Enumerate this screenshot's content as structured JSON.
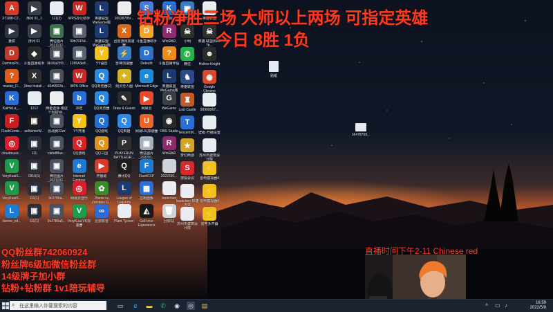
{
  "overlays": {
    "title_line1": "钻粉净胜三场 大师以上两场 可指定英雄",
    "title_line2": "今日 8胜 1负",
    "fan_lines": [
      "QQ粉丝群742060924",
      "粉丝牌6级加微信粉丝群",
      "14级牌子加小群",
      "钻粉+钻粉群 1v1陪玩辅导"
    ],
    "live_time": "直播时间下午2-11 Chinese red"
  },
  "desktop_icons": [
    {
      "label": "XTU88-C2...",
      "color": "#d23b2b",
      "glyph": "A"
    },
    {
      "label": "序列 01_1",
      "color": "#3a3f48",
      "glyph": "▶"
    },
    {
      "label": "111(2)",
      "color": "#e9edf2",
      "glyph": ""
    },
    {
      "label": "WPS办公助手",
      "color": "#c62828",
      "glyph": "W"
    },
    {
      "label": "英雄联盟WeGame版",
      "color": "#1c3a6e",
      "glyph": "L"
    },
    {
      "label": "10028785r...",
      "color": "#ededed",
      "glyph": ""
    },
    {
      "label": "搜狗",
      "color": "#4b7bd8",
      "glyph": "S"
    },
    {
      "label": "酷狗",
      "color": "#2a71d6",
      "glyph": "K"
    },
    {
      "label": "量腐",
      "color": "#2f3440",
      "glyph": "▶"
    },
    {
      "label": "序列 01",
      "color": "#3a3f48",
      "glyph": "▶"
    },
    {
      "label": "微信图片_2021102...",
      "color": "#3f6e4a",
      "glyph": "▣"
    },
    {
      "label": "90b7615d...",
      "color": "#5a5f6b",
      "glyph": "▣"
    },
    {
      "label": "英雄联盟WeGame版",
      "color": "#1c3a6e",
      "glyph": "L"
    },
    {
      "label": "迅雷游戏加速器",
      "color": "#d86a1e",
      "glyph": "X"
    },
    {
      "label": "斗鱼直播助手",
      "color": "#f2a431",
      "glyph": "D"
    },
    {
      "label": "WinRAR",
      "color": "#8e2b6d",
      "glyph": "R"
    },
    {
      "label": "DaminoPri...",
      "color": "#c0392b",
      "glyph": "D"
    },
    {
      "label": "斗鱼直播助手",
      "color": "#2a2a2a",
      "glyph": "◆"
    },
    {
      "label": "9b16a23f3...",
      "color": "#4c4f57",
      "glyph": "▣"
    },
    {
      "label": "1285A3e8...",
      "color": "#596274",
      "glyph": "▣"
    },
    {
      "label": "YY语音",
      "color": "#f4c21b",
      "glyph": "Y"
    },
    {
      "label": "雷神加速器",
      "color": "#3a7cc4",
      "glyph": "⚡"
    },
    {
      "label": "DetectIt",
      "color": "#2b70c9",
      "glyph": "D"
    },
    {
      "label": "斗鱼直播伴侣",
      "color": "#f08a1c",
      "glyph": "?"
    },
    {
      "label": "master_D...",
      "color": "#e05c1a",
      "glyph": "?"
    },
    {
      "label": "Xbox Install...",
      "color": "#2e2e2e",
      "glyph": "X"
    },
    {
      "label": "d2d9502b...",
      "color": "#4c4f57",
      "glyph": "▣"
    },
    {
      "label": "WPS Office",
      "color": "#c62828",
      "glyph": "W"
    },
    {
      "label": "QQ浏览器(2)",
      "color": "#2a8ae3",
      "glyph": "Q"
    },
    {
      "label": "剑灵无人图",
      "color": "#d4b226",
      "glyph": "✦"
    },
    {
      "label": "Microsoft Edge",
      "color": "#1d8ad8",
      "glyph": "e"
    },
    {
      "label": "英雄联盟WeGame版",
      "color": "#1c3a6e",
      "glyph": "L"
    },
    {
      "label": "KaiHeLa_...",
      "color": "#2a6cd8",
      "glyph": "K"
    },
    {
      "label": "1212",
      "color": "#e9edf2",
      "glyph": ""
    },
    {
      "label": "两者选择-用这个包括Wi...",
      "color": "#ededed",
      "glyph": ""
    },
    {
      "label": "中旺",
      "color": "#2b6fd6",
      "glyph": "b"
    },
    {
      "label": "QQ浏览器",
      "color": "#2a8ae3",
      "glyph": "Q"
    },
    {
      "label": "Draw & Guess",
      "color": "#2b2b2b",
      "glyph": "✎"
    },
    {
      "label": "网易云",
      "color": "#e64a2a",
      "glyph": "▶"
    },
    {
      "label": "WeGame",
      "color": "#3b3f45",
      "glyph": "G"
    },
    {
      "label": "FlashCente...",
      "color": "#c81e1e",
      "glyph": "F"
    },
    {
      "label": "aeNemieW...",
      "color": "#1d1d1d",
      "glyph": "▣"
    },
    {
      "label": "原战赛22zz",
      "color": "#4a4f5a",
      "glyph": "▣"
    },
    {
      "label": "YY开播",
      "color": "#f4c21b",
      "glyph": "Y"
    },
    {
      "label": "QQ游戏",
      "color": "#2470d0",
      "glyph": "Q"
    },
    {
      "label": "QQ英雄",
      "color": "#2d89e5",
      "glyph": "Q"
    },
    {
      "label": "网易UU加速器",
      "color": "#e8662a",
      "glyph": "U"
    },
    {
      "label": "OBS Studio",
      "color": "#2a2a2a",
      "glyph": "◉"
    },
    {
      "label": "cloudmusic...",
      "color": "#d81e2a",
      "glyph": "◎"
    },
    {
      "label": "111",
      "color": "#2a2f3a",
      "glyph": "▣"
    },
    {
      "label": "clafe88ae...",
      "color": "#4a5160",
      "glyph": "▣"
    },
    {
      "label": "QQ游戏",
      "color": "#d52626",
      "glyph": "Q"
    },
    {
      "label": "QQ三国",
      "color": "#e0921e",
      "glyph": "Q"
    },
    {
      "label": "PLAYERUN BATTLEGR...",
      "color": "#2f2f2f",
      "glyph": "P"
    },
    {
      "label": "微信图片_202201...",
      "color": "#a8b0bc",
      "glyph": "▣"
    },
    {
      "label": "WinRAR",
      "color": "#8e2b6d",
      "glyph": "R"
    },
    {
      "label": "VeryKuaiS...",
      "color": "#1f9a4a",
      "glyph": "V"
    },
    {
      "label": "0916(1)",
      "color": "#2a2f3a",
      "glyph": "▣"
    },
    {
      "label": "微信图片_2021102...",
      "color": "#4a5160",
      "glyph": "▣"
    },
    {
      "label": "Internet Explorer",
      "color": "#1f7ad1",
      "glyph": "e"
    },
    {
      "label": "开播助",
      "color": "#d53a2a",
      "glyph": "▶"
    },
    {
      "label": "腾讯QQ",
      "color": "#1c1c1c",
      "glyph": "Q"
    },
    {
      "label": "FlashFXP",
      "color": "#1f7ad1",
      "glyph": "F"
    },
    {
      "label": "2022030...",
      "color": "#cfd4db",
      "glyph": ""
    },
    {
      "label": "VeryKuaiS...",
      "color": "#1f9a4a",
      "glyph": "V"
    },
    {
      "label": "111(1)",
      "color": "#2a2f3a",
      "glyph": "▣"
    },
    {
      "label": "9c2780a...",
      "color": "#4a5160",
      "glyph": "▣"
    },
    {
      "label": "网易云音乐",
      "color": "#d81e2a",
      "glyph": "◎"
    },
    {
      "label": "Plants vs Zombies G...",
      "color": "#3a8a2b",
      "glyph": "✿"
    },
    {
      "label": "League of Legends",
      "color": "#1c3a6e",
      "glyph": "L"
    },
    {
      "label": "控制面板",
      "color": "#2b6fd6",
      "glyph": "▦"
    },
    {
      "label": "Isuoichen",
      "color": "#e9edf2",
      "glyph": ""
    },
    {
      "label": "liveme_ed...",
      "color": "#1f7ad1",
      "glyph": "L"
    },
    {
      "label": "111(1)",
      "color": "#2a2f3a",
      "glyph": "▣"
    },
    {
      "label": "9c2780a5...",
      "color": "#4a5160",
      "glyph": "▣"
    },
    {
      "label": "VeryKuai.VK加速器",
      "color": "#1f9a4a",
      "glyph": "V"
    },
    {
      "label": "迅雷影音",
      "color": "#2a6cd8",
      "glyph": "∞"
    },
    {
      "label": "Plant Tycoon",
      "color": "#e9edf2",
      "glyph": ""
    },
    {
      "label": "GeForce Experience",
      "color": "#1a1a1a",
      "glyph": "◭"
    },
    {
      "label": "回收站",
      "color": "#cfd4db",
      "glyph": "🗑"
    }
  ],
  "right_icons": [
    {
      "label": "快捷方式(2)",
      "color": "#3a7cc4",
      "glyph": "▣"
    },
    {
      "label": "英雄联盟",
      "color": "#e9edf2",
      "glyph": ""
    },
    {
      "label": "小明",
      "color": "#2f2f2f",
      "glyph": "☠"
    },
    {
      "label": "英雄 联盟(Skul Th...",
      "color": "#2f2f2f",
      "glyph": "☠"
    },
    {
      "label": "微信",
      "color": "#24b24a",
      "glyph": "✆"
    },
    {
      "label": "Hollow Knight",
      "color": "#2b2b2b",
      "glyph": "☻"
    },
    {
      "label": "英雄联盟",
      "color": "#2d4a8a",
      "glyph": "♞"
    },
    {
      "label": "Google Chrome",
      "color": "#d84a2b",
      "glyph": "◉"
    },
    {
      "label": "Lost Castle",
      "color": "#c05a2b",
      "glyph": "♜"
    },
    {
      "label": "99900067...",
      "color": "#e9edf2",
      "glyph": ""
    },
    {
      "label": "TencentM...",
      "color": "#2b6fd6",
      "glyph": "T"
    },
    {
      "label": "壁纸-开播设置",
      "color": "#e9edf2",
      "glyph": ""
    },
    {
      "label": "梦幻西游",
      "color": "#d5a52a",
      "glyph": "★"
    },
    {
      "label": "苏州市建筑设计院",
      "color": "#e9edf2",
      "glyph": ""
    },
    {
      "label": "搜狐会议",
      "color": "#d52a2a",
      "glyph": "S"
    },
    {
      "label": "雷电模拟器4",
      "color": "#f0c020",
      "glyph": "⚡"
    },
    {
      "label": "Isuoichen 快捷方式",
      "color": "#e9edf2",
      "glyph": ""
    },
    {
      "label": "雷电模拟器4",
      "color": "#f0c020",
      "glyph": "⚡"
    },
    {
      "label": "苏州市建筑设计院",
      "color": "#e9edf2",
      "glyph": ""
    },
    {
      "label": "雷电多开器",
      "color": "#f0c020",
      "glyph": "⚡"
    }
  ],
  "desktop_files": [
    {
      "label": "贴纸"
    },
    {
      "label": "16478769..."
    }
  ],
  "taskbar": {
    "search_placeholder": "在这里输入你要搜索的内容",
    "time": "16:59",
    "date": "2022/5/9"
  }
}
